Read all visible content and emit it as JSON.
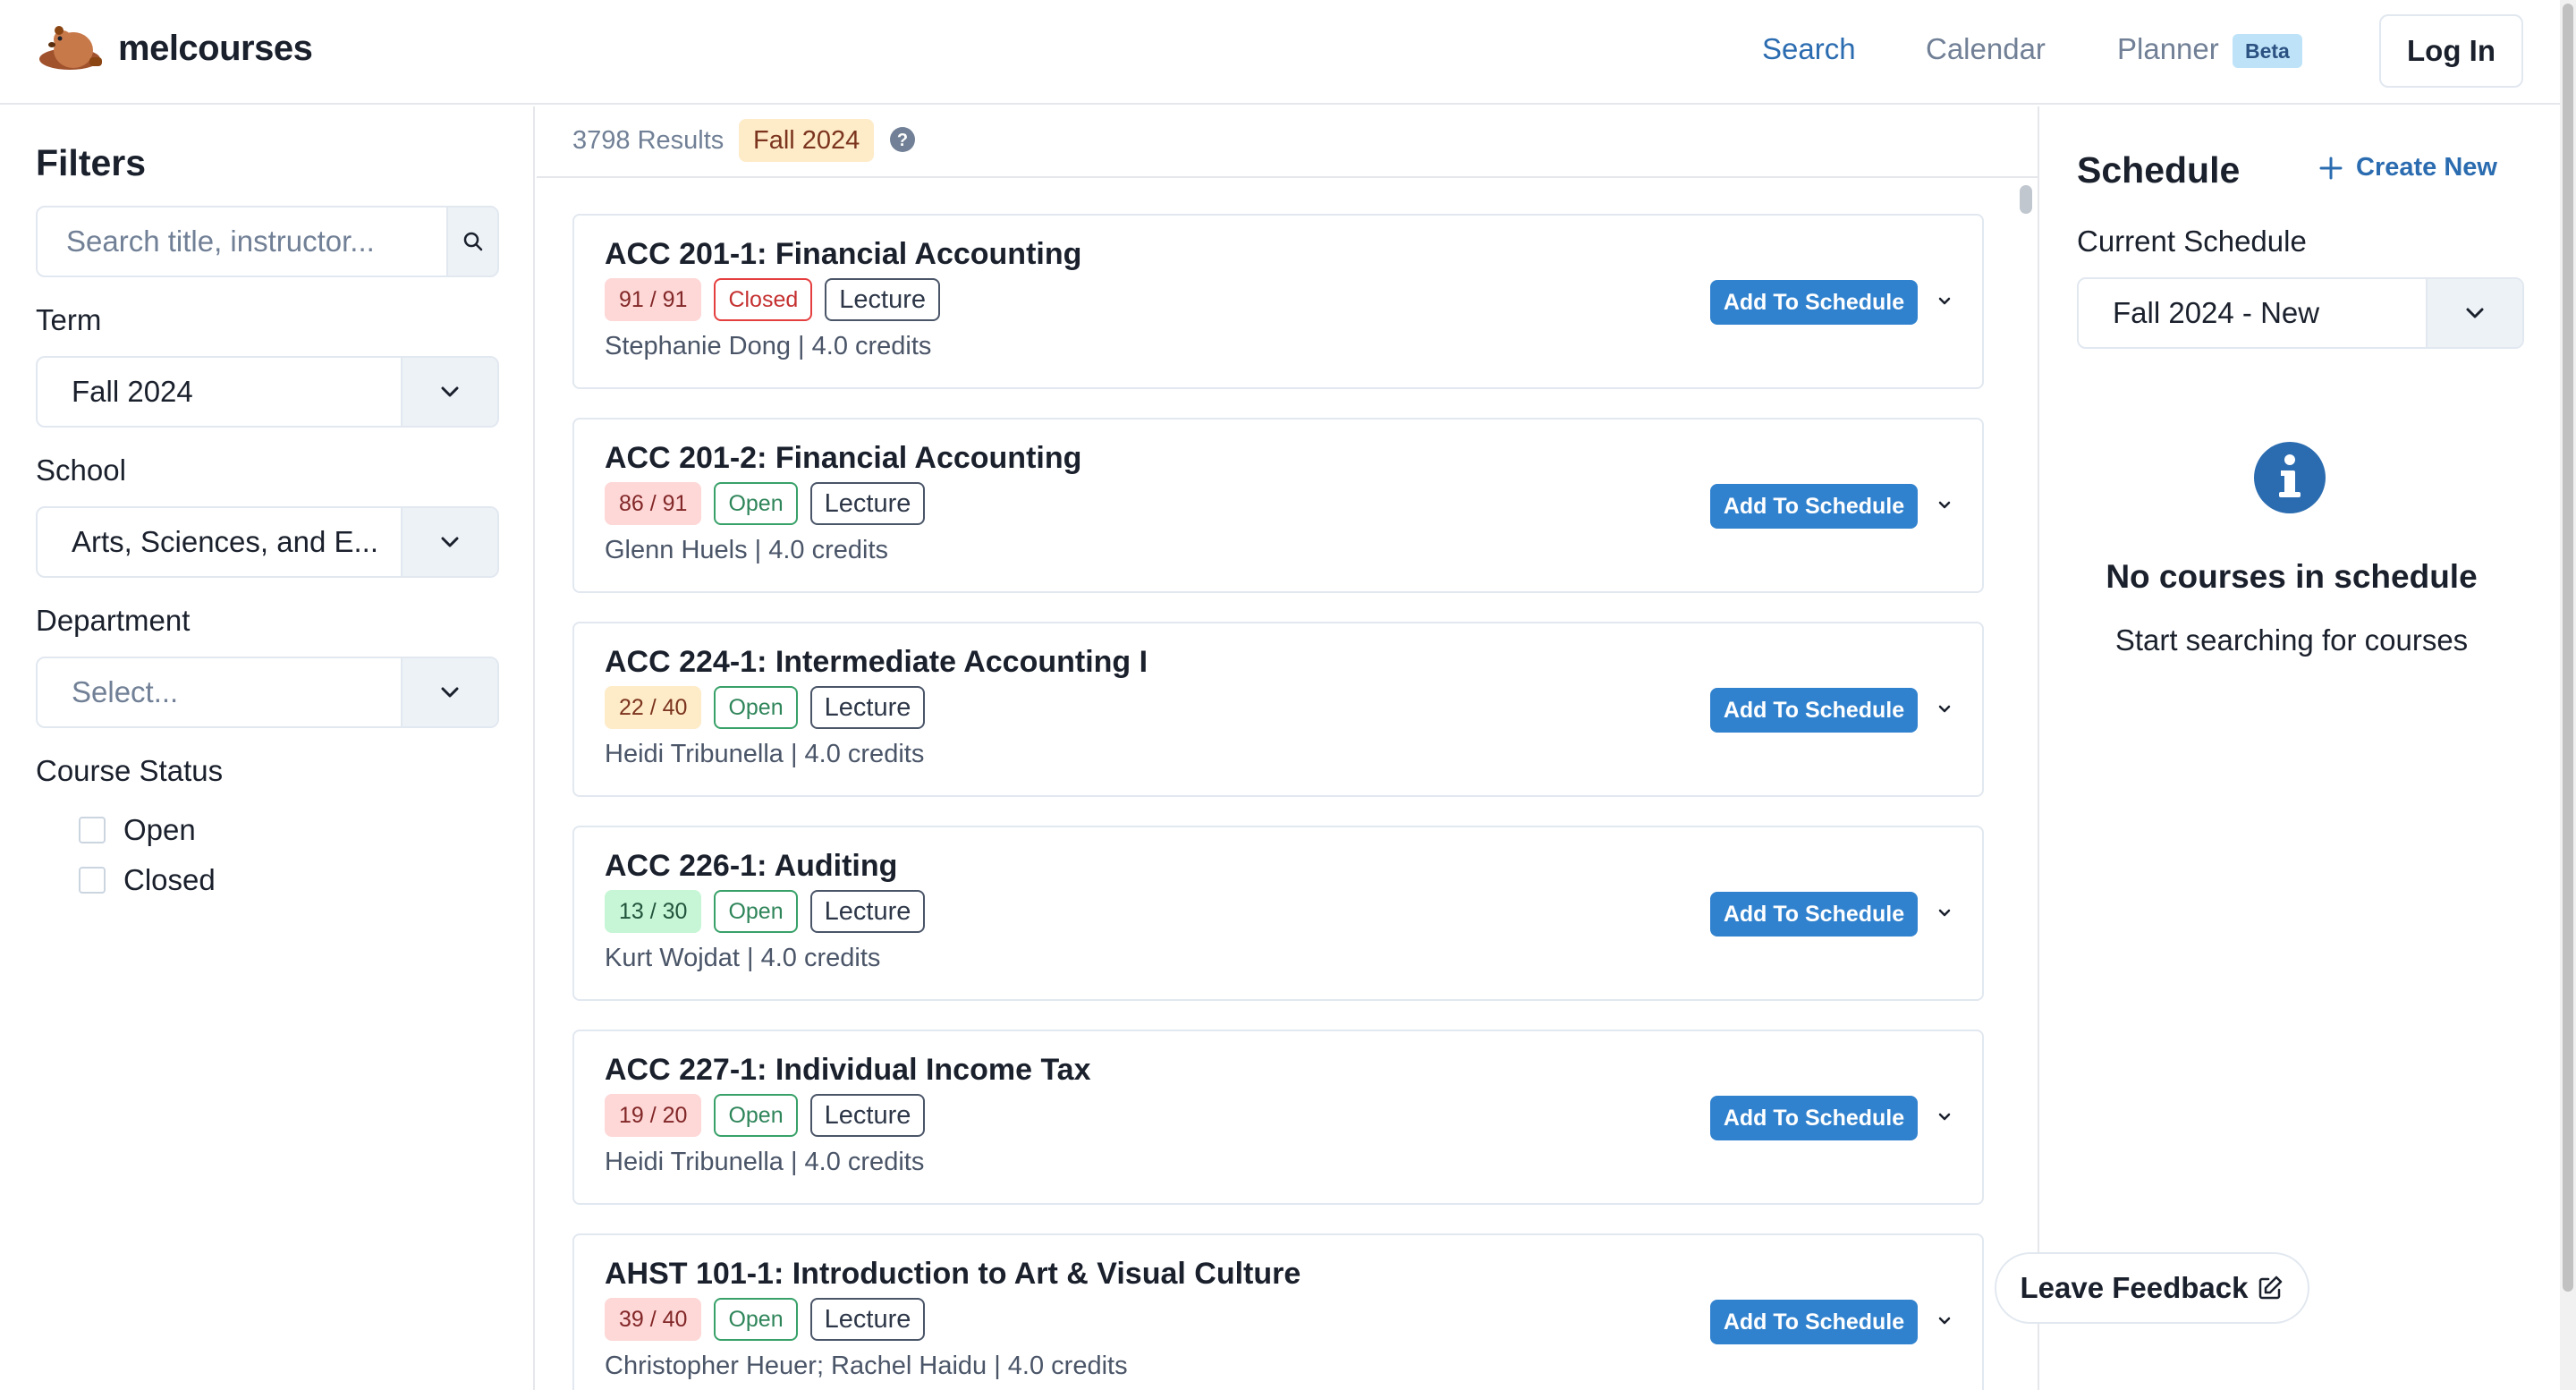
{
  "brand": {
    "name": "melcourses",
    "logo_icon": "beaver-logo-icon"
  },
  "nav": {
    "search": "Search",
    "calendar": "Calendar",
    "planner": "Planner",
    "beta": "Beta",
    "login": "Log In",
    "active": "Search"
  },
  "filters": {
    "title": "Filters",
    "search_placeholder": "Search title, instructor...",
    "term_label": "Term",
    "term_value": "Fall 2024",
    "school_label": "School",
    "school_value": "Arts, Sciences, and E...",
    "department_label": "Department",
    "department_placeholder": "Select...",
    "status_label": "Course Status",
    "status_options": [
      {
        "label": "Open",
        "checked": false
      },
      {
        "label": "Closed",
        "checked": false
      }
    ]
  },
  "results": {
    "count": "3798 Results",
    "term_badge": "Fall 2024"
  },
  "courses": [
    {
      "title": "ACC 201-1: Financial Accounting",
      "seats": "91 / 91",
      "seat_color": "red",
      "status": "Closed",
      "type": "Lecture",
      "subtitle": "Stephanie Dong | 4.0 credits",
      "button": "Add To Schedule"
    },
    {
      "title": "ACC 201-2: Financial Accounting",
      "seats": "86 / 91",
      "seat_color": "red",
      "status": "Open",
      "type": "Lecture",
      "subtitle": "Glenn Huels | 4.0 credits",
      "button": "Add To Schedule"
    },
    {
      "title": "ACC 224-1: Intermediate Accounting I",
      "seats": "22 / 40",
      "seat_color": "yellow",
      "status": "Open",
      "type": "Lecture",
      "subtitle": "Heidi Tribunella | 4.0 credits",
      "button": "Add To Schedule"
    },
    {
      "title": "ACC 226-1: Auditing",
      "seats": "13 / 30",
      "seat_color": "green",
      "status": "Open",
      "type": "Lecture",
      "subtitle": "Kurt Wojdat | 4.0 credits",
      "button": "Add To Schedule"
    },
    {
      "title": "ACC 227-1: Individual Income Tax",
      "seats": "19 / 20",
      "seat_color": "red",
      "status": "Open",
      "type": "Lecture",
      "subtitle": "Heidi Tribunella | 4.0 credits",
      "button": "Add To Schedule"
    },
    {
      "title": "AHST 101-1: Introduction to Art & Visual Culture",
      "seats": "39 / 40",
      "seat_color": "red",
      "status": "Open",
      "type": "Lecture",
      "subtitle": "Christopher Heuer; Rachel Haidu | 4.0 credits",
      "button": "Add To Schedule"
    }
  ],
  "schedule": {
    "title": "Schedule",
    "create_new": "Create New",
    "current_label": "Current Schedule",
    "current_value": "Fall 2024 - New",
    "empty_title": "No courses in schedule",
    "empty_subtitle": "Start searching for courses"
  },
  "feedback": {
    "label": "Leave Feedback"
  },
  "colors": {
    "accent": "#3182ce",
    "link": "#2b6cb0",
    "closed": "#e53e3e",
    "open": "#38a169"
  }
}
